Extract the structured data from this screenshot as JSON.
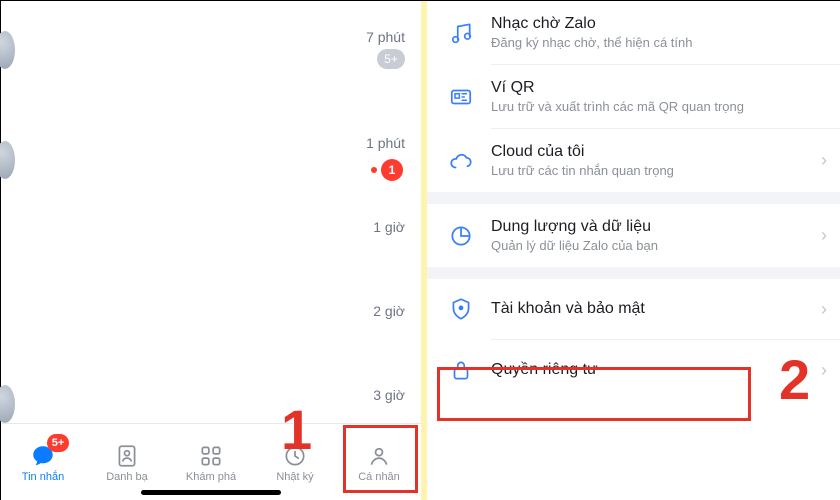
{
  "left": {
    "chats": [
      {
        "time": "7 phút",
        "unread": "5+",
        "unread_kind": "gray"
      },
      {
        "time": "1 phút",
        "unread": "1",
        "unread_kind": "red",
        "has_dot": true
      },
      {
        "time": "1 giờ"
      },
      {
        "time": "2 giờ"
      },
      {
        "time": "3 giờ"
      }
    ],
    "tabs": {
      "messages": {
        "label": "Tin nhắn",
        "badge": "5+"
      },
      "contacts": {
        "label": "Danh bạ"
      },
      "discover": {
        "label": "Khám phá"
      },
      "timeline": {
        "label": "Nhật ký"
      },
      "profile": {
        "label": "Cá nhân"
      }
    }
  },
  "right": {
    "ringtone": {
      "title": "Nhạc chờ Zalo",
      "sub": "Đăng ký nhạc chờ, thể hiện cá tính"
    },
    "wallet": {
      "title": "Ví QR",
      "sub": "Lưu trữ và xuất trình các mã QR quan trọng"
    },
    "cloud": {
      "title": "Cloud của tôi",
      "sub": "Lưu trữ các tin nhắn quan trọng"
    },
    "storage": {
      "title": "Dung lượng và dữ liệu",
      "sub": "Quản lý dữ liệu Zalo của bạn"
    },
    "security": {
      "title": "Tài khoản và bảo mật"
    },
    "privacy": {
      "title": "Quyền riêng tư"
    }
  },
  "annot": {
    "one": "1",
    "two": "2"
  }
}
